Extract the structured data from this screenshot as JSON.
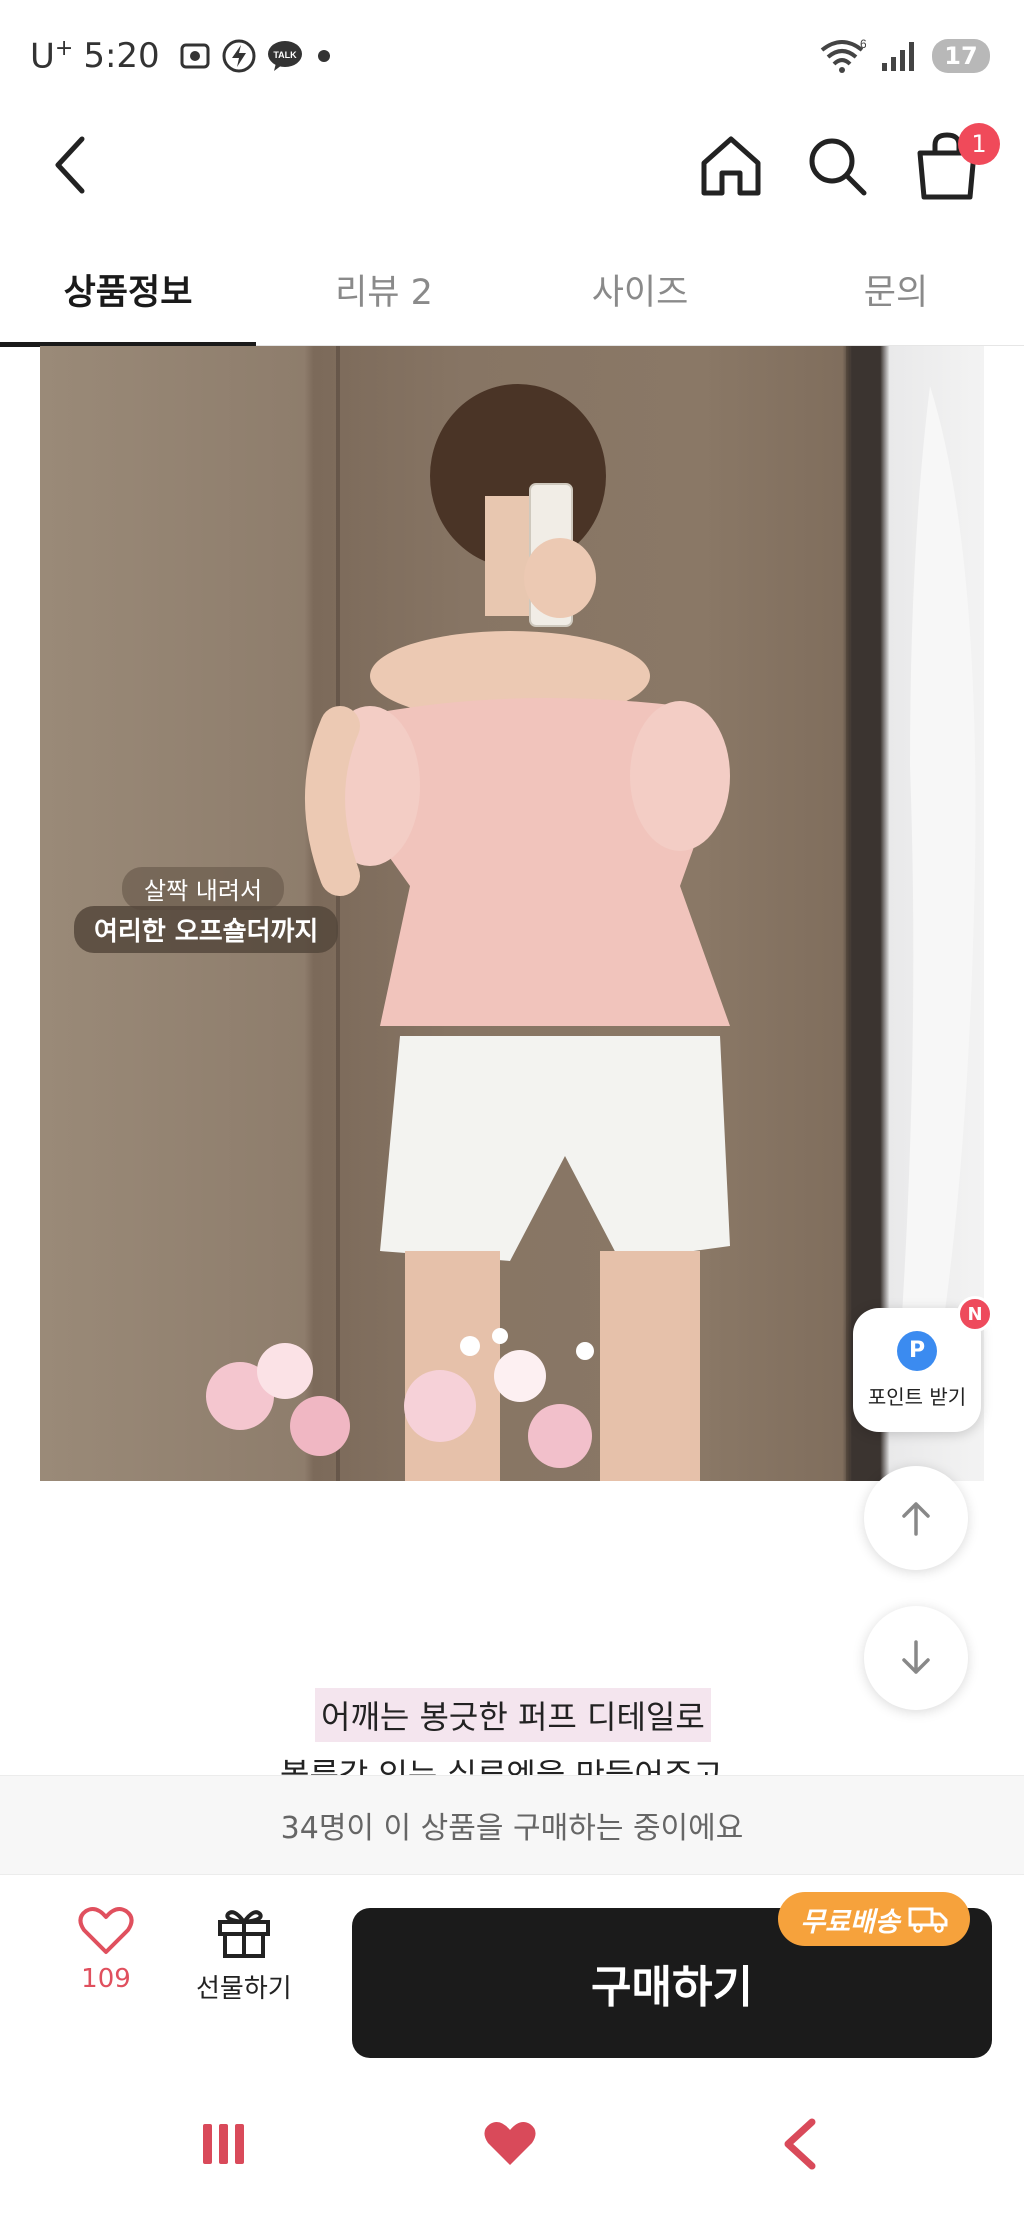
{
  "status_bar": {
    "carrier": "U",
    "carrier_sup": "+",
    "time": "5:20",
    "battery": "17",
    "wifi_badge": "6"
  },
  "nav": {
    "cart_count": "1"
  },
  "tabs": [
    {
      "label": "상품정보",
      "active": true
    },
    {
      "label": "리뷰 2",
      "active": false
    },
    {
      "label": "사이즈",
      "active": false
    },
    {
      "label": "문의",
      "active": false
    }
  ],
  "image_captions": {
    "line1": "살짝 내려서",
    "line2": "여리한 오프숄더까지"
  },
  "points_fab": {
    "icon_letter": "P",
    "label": "포인트 받기",
    "new_badge": "N"
  },
  "description": {
    "line1": "어깨는 봉긋한 퍼프 디테일로",
    "line2": "볼륨감 있는 실루엣을 만들어주고"
  },
  "buying_banner": "34명이 이 상품을 구매하는 중이에요",
  "action_bar": {
    "like_count": "109",
    "gift_label": "선물하기",
    "buy_label": "구매하기",
    "free_shipping": "무료배송"
  },
  "colors": {
    "accent": "#1b1b1b",
    "badge_red": "#f04a5a",
    "free_ship_orange": "#f6a23c",
    "like_red": "#e0505e"
  }
}
